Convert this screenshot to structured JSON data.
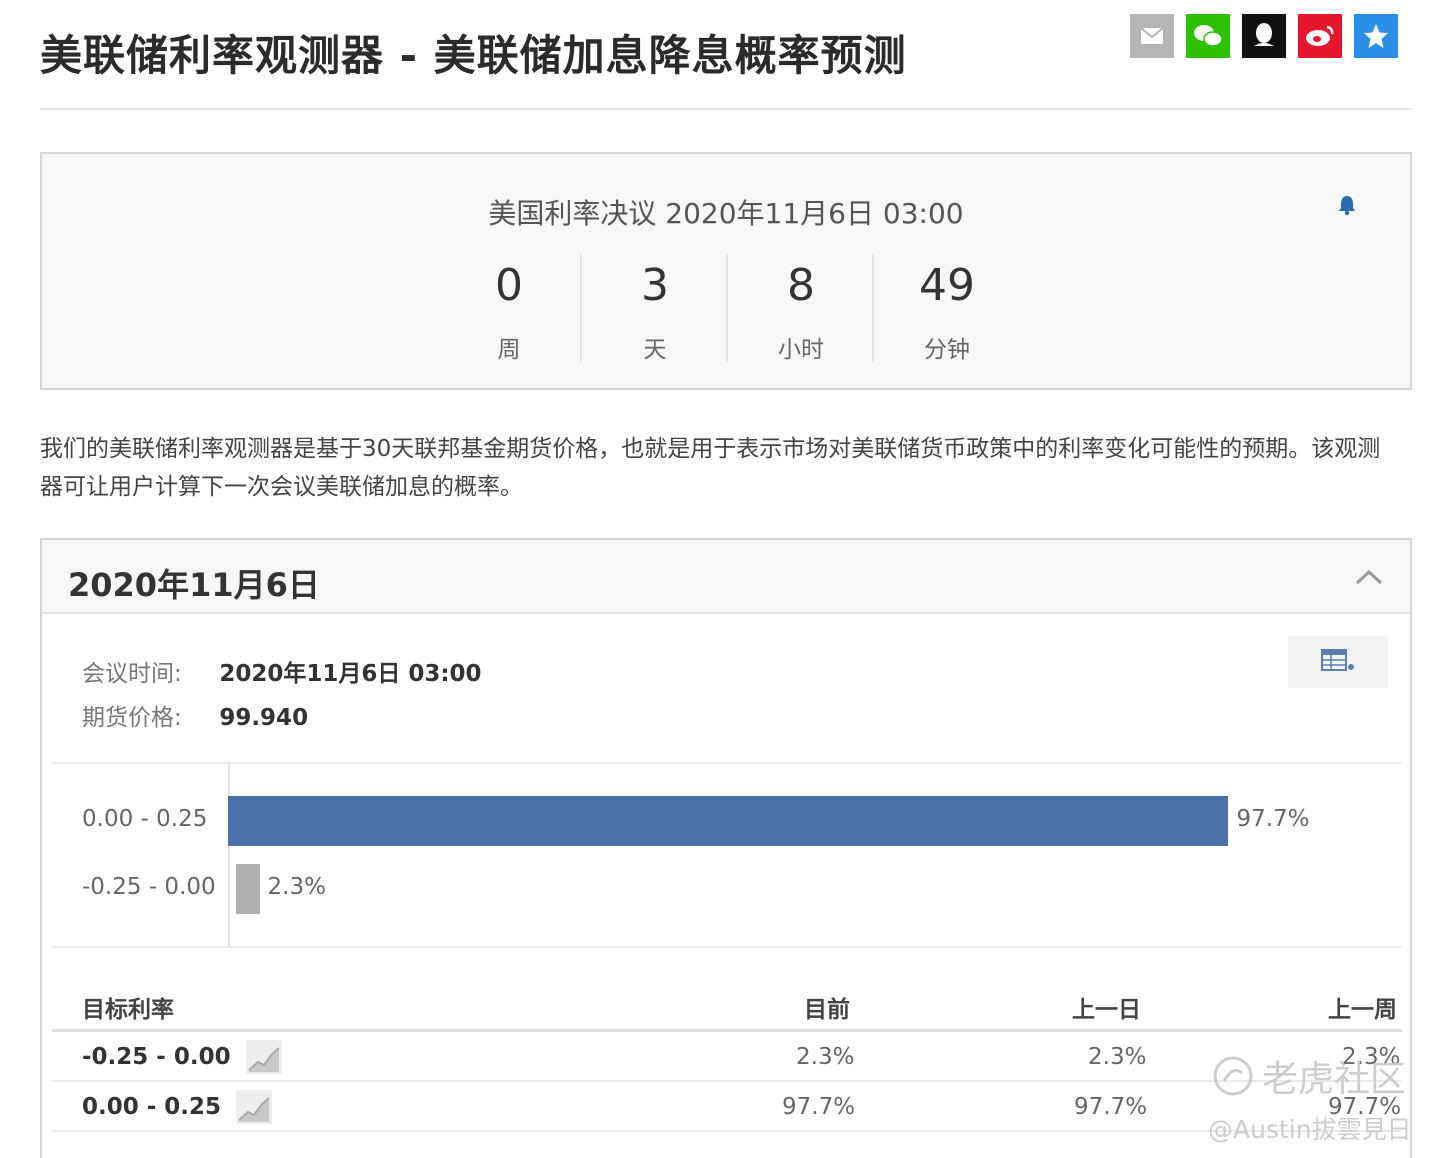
{
  "page": {
    "title": "美联储利率观测器 - 美联储加息降息概率预测"
  },
  "share": [
    {
      "icon": "email-icon",
      "color": "#b5b5b5",
      "glyph": "✉"
    },
    {
      "icon": "wechat-icon",
      "color": "#2dc100",
      "glyph": "●"
    },
    {
      "icon": "qq-icon",
      "color": "#111111",
      "glyph": "♟"
    },
    {
      "icon": "weibo-icon",
      "color": "#e6162d",
      "glyph": "◉"
    },
    {
      "icon": "qzone-icon",
      "color": "#2b8ee8",
      "glyph": "★"
    }
  ],
  "countdown": {
    "heading": "美国利率决议 2020年11月6日 03:00",
    "units": [
      {
        "value": "0",
        "label": "周"
      },
      {
        "value": "3",
        "label": "天"
      },
      {
        "value": "8",
        "label": "小时"
      },
      {
        "value": "49",
        "label": "分钟"
      }
    ]
  },
  "description": "我们的美联储利率观测器是基于30天联邦基金期货价格，也就是用于表示市场对美联储货币政策中的利率变化可能性的预期。该观测器可让用户计算下一次会议美联储加息的概率。",
  "meeting": {
    "date_heading": "2020年11月6日",
    "time_label": "会议时间:",
    "time_value": "2020年11月6日 03:00",
    "price_label": "期货价格:",
    "price_value": "99.940"
  },
  "colors": {
    "primary_bar": "#4a71a8",
    "secondary_bar": "#b0b0b0"
  },
  "chart_data": {
    "type": "bar",
    "orientation": "horizontal",
    "categories": [
      "0.00 - 0.25",
      "-0.25 - 0.00"
    ],
    "values": [
      97.7,
      2.3
    ],
    "value_labels": [
      "97.7%",
      "2.3%"
    ],
    "xlim": [
      0,
      100
    ]
  },
  "table": {
    "headers": [
      "目标利率",
      "目前",
      "上一日",
      "上一周"
    ],
    "rows": [
      {
        "rate": "-0.25 - 0.00",
        "current": "2.3%",
        "prev_day": "2.3%",
        "prev_week": "2.3%"
      },
      {
        "rate": "0.00 - 0.25",
        "current": "97.7%",
        "prev_day": "97.7%",
        "prev_week": "97.7%"
      }
    ]
  },
  "watermark": {
    "brand": "老虎社区",
    "user": "@Austin拔雲見日"
  }
}
